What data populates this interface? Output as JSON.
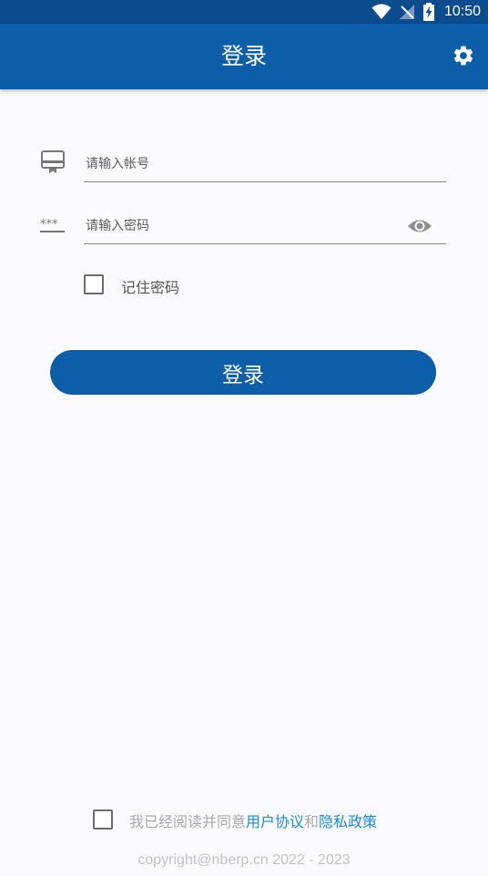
{
  "status_bar": {
    "time": "10:50",
    "icons": [
      "wifi-icon",
      "no-signal-icon",
      "battery-charging-icon"
    ]
  },
  "app_bar": {
    "title": "登录",
    "settings_icon": "gear-icon"
  },
  "form": {
    "account_placeholder": "请输入帐号",
    "account_icon": "account-card-icon",
    "password_placeholder": "请输入密码",
    "password_icon": "password-dots-icon",
    "show_password_icon": "eye-icon",
    "remember_label": "记住密码",
    "remember_checked": false,
    "login_label": "登录"
  },
  "agreement": {
    "checked": false,
    "prefix": "我已经阅读并同意",
    "user_agreement": "用户协议",
    "and": "和",
    "privacy_policy": "隐私政策"
  },
  "footer": {
    "copyright": "copyright@nberp.cn 2022 - 2023"
  },
  "colors": {
    "primary": "#0d5ea8",
    "status_bar": "#0a4c8e",
    "link": "#1c8ad8",
    "background": "#fbfbfd"
  }
}
